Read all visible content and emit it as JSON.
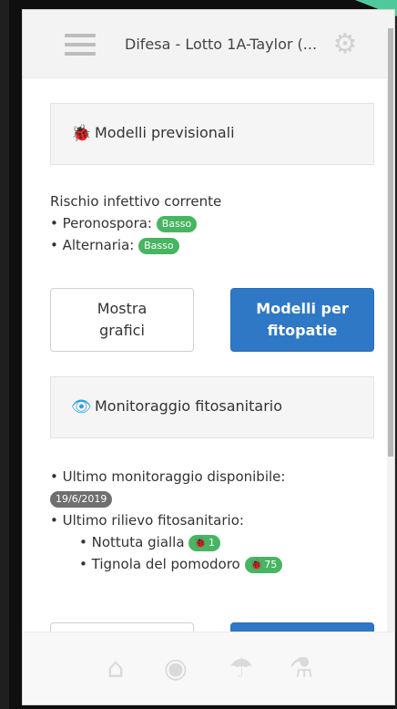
{
  "header": {
    "title": "Difesa - Lotto 1A-Taylor (..."
  },
  "sections": {
    "models": {
      "title": "Modelli previsionali",
      "icon": "bug-icon"
    },
    "risk": {
      "heading": "Rischio infettivo corrente",
      "items": [
        {
          "label": "Peronospora:",
          "badge": "Basso"
        },
        {
          "label": "Alternaria:",
          "badge": "Basso"
        }
      ]
    },
    "buttons": {
      "charts": "Mostra\ngrafici",
      "models": "Modelli per\nfitopatie"
    },
    "monitoring": {
      "title": "Monitoraggio fitosanitario",
      "icon": "eye-icon",
      "latest_label": "Ultimo monitoraggio disponibile:",
      "latest_date": "19/6/2019",
      "survey_label": "Ultimo rilievo fitosanitario:",
      "items": [
        {
          "label": "Nottuta gialla",
          "count": "1"
        },
        {
          "label": "Tignola del pomodoro",
          "count": "75"
        }
      ]
    }
  },
  "tabs": [
    {
      "name": "home-tab",
      "icon": "home-icon"
    },
    {
      "name": "dashboard-tab",
      "icon": "palette-icon"
    },
    {
      "name": "weather-tab",
      "icon": "umbrella-icon"
    },
    {
      "name": "lab-tab",
      "icon": "flask-icon"
    }
  ]
}
